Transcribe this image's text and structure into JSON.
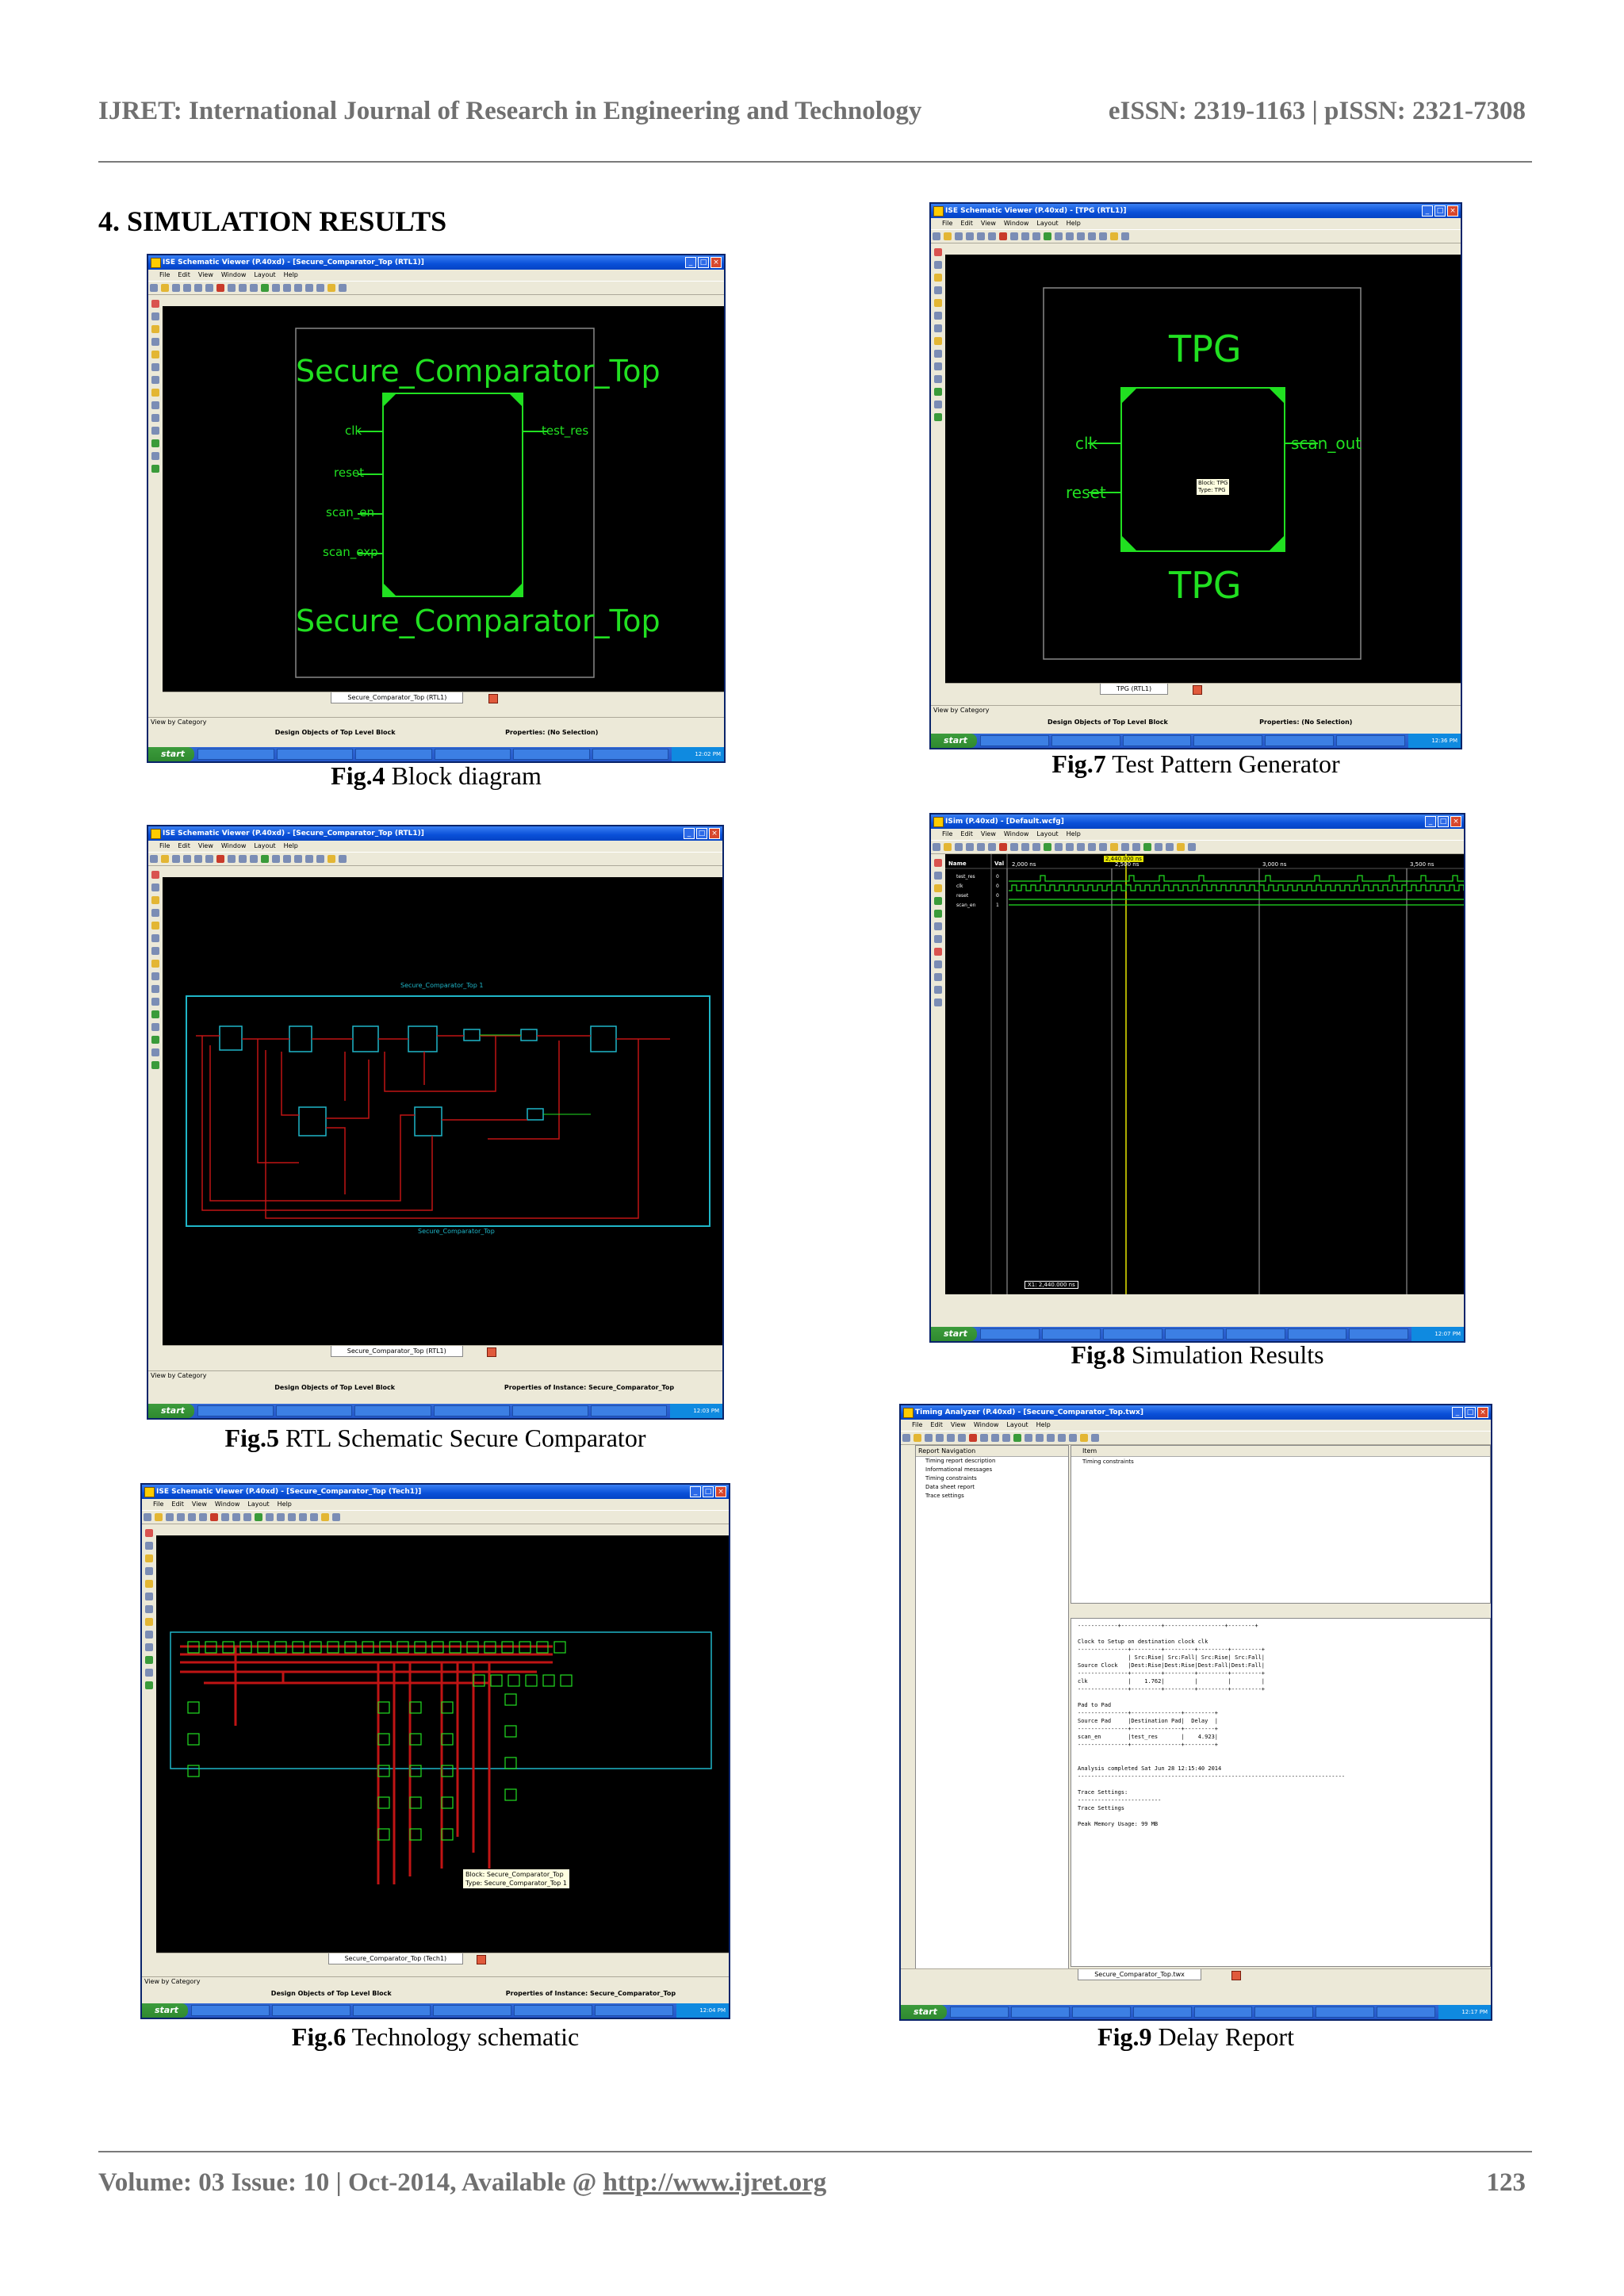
{
  "header": {
    "journal": "IJRET: International Journal of Research in Engineering and Technology",
    "issn": "eISSN: 2319-1163 | pISSN: 2321-7308"
  },
  "section": {
    "title": "4. SIMULATION RESULTS"
  },
  "figures": {
    "fig4": {
      "label": "Fig.4",
      "caption": "Block diagram",
      "window_title": "ISE Schematic Viewer (P.40xd) - [Secure_Comparator_Top (RTL1)]",
      "block_name": "Secure_Comparator_Top",
      "ports_in": [
        "clk",
        "reset",
        "scan_en",
        "scan_exp"
      ],
      "port_out": "test_res",
      "tab": "Secure_Comparator_Top (RTL1)",
      "view_by": "View by Category",
      "pane_left": "Design Objects of Top Level Block",
      "pane_right": "Properties: (No Selection)",
      "start": "start",
      "clock": "12:02 PM"
    },
    "fig5": {
      "label": "Fig.5",
      "caption": "RTL Schematic Secure Comparator",
      "window_title": "ISE Schematic Viewer (P.40xd) - [Secure_Comparator_Top (RTL1)]",
      "tab": "Secure_Comparator_Top (RTL1)",
      "view_by": "View by Category",
      "pane_left": "Design Objects of Top Level Block",
      "pane_right": "Properties of Instance: Secure_Comparator_Top",
      "top_label": "Secure_Comparator_Top 1",
      "bottom_label": "Secure_Comparator_Top",
      "start": "start",
      "clock": "12:03 PM"
    },
    "fig6": {
      "label": "Fig.6",
      "caption": "Technology schematic",
      "window_title": "ISE Schematic Viewer (P.40xd) - [Secure_Comparator_Top (Tech1)]",
      "tab": "Secure_Comparator_Top (Tech1)",
      "view_by": "View by Category",
      "pane_left": "Design Objects of Top Level Block",
      "pane_right": "Properties of Instance: Secure_Comparator_Top",
      "tooltip_block": "Block: Secure_Comparator_Top",
      "tooltip_type": "Type: Secure_Comparator_Top 1",
      "start": "start",
      "clock": "12:04 PM"
    },
    "fig7": {
      "label": "Fig.7",
      "caption": "Test Pattern Generator",
      "window_title": "ISE Schematic Viewer (P.40xd) - [TPG (RTL1)]",
      "block_name": "TPG",
      "ports_in": [
        "clk",
        "reset"
      ],
      "port_out": "scan_out",
      "tooltip_block": "Block: TPG",
      "tooltip_type": "Type: TPG",
      "tab": "TPG (RTL1)",
      "view_by": "View by Category",
      "pane_left": "Design Objects of Top Level Block",
      "pane_right": "Properties: (No Selection)",
      "start": "start",
      "clock": "12:36 PM"
    },
    "fig8": {
      "label": "Fig.8",
      "caption": "Simulation Results",
      "window_title": "ISim (P.40xd) - [Default.wcfg]",
      "cursor_time": "2,440.000 ns",
      "ticks": [
        "2,000 ns",
        "2,500 ns",
        "3,000 ns",
        "3,500 ns"
      ],
      "signal_header": [
        "Name",
        "Val"
      ],
      "signals": [
        {
          "name": "test_res",
          "value": "0"
        },
        {
          "name": "clk",
          "value": "0"
        },
        {
          "name": "reset",
          "value": "0"
        },
        {
          "name": "scan_en",
          "value": "1"
        }
      ],
      "marker": "X1: 2,440.000 ns",
      "start": "start",
      "clock": "12:07 PM"
    },
    "fig9": {
      "label": "Fig.9",
      "caption": "Delay Report",
      "window_title": "Timing Analyzer (P.40xd) - [Secure_Comparator_Top.twx]",
      "nav_header": "Report Navigation",
      "nav_items": [
        "Timing report description",
        "Informational messages",
        "Timing constraints",
        "Data sheet report",
        "Trace settings"
      ],
      "item_header": "Item",
      "item_row": "Timing constraints",
      "report_lines": [
        "------------+------------+------------------+--------+",
        "",
        "Clock to Setup on destination clock clk",
        "---------------+---------+---------+---------+---------+",
        "               | Src:Rise| Src:Fall| Src:Rise| Src:Fall|",
        "Source Clock   |Dest:Rise|Dest:Rise|Dest:Fall|Dest:Fall|",
        "---------------+---------+---------+---------+---------+",
        "clk            |    1.762|         |         |         |",
        "---------------+---------+---------+---------+---------+",
        "",
        "Pad to Pad",
        "---------------+---------------+---------+",
        "Source Pad     |Destination Pad|  Delay  |",
        "---------------+---------------+---------+",
        "scan_en        |test_res       |    4.923|",
        "---------------+---------------+---------+",
        "",
        "",
        "Analysis completed Sat Jun 28 12:15:40 2014",
        "--------------------------------------------------------------------------------",
        "",
        "Trace Settings:",
        "-------------------------",
        "Trace Settings",
        "",
        "Peak Memory Usage: 99 MB"
      ],
      "tab": "Secure_Comparator_Top.twx",
      "start": "start",
      "clock": "12:17 PM"
    }
  },
  "menus": [
    "File",
    "Edit",
    "View",
    "Window",
    "Layout",
    "Help"
  ],
  "footer": {
    "left": "Volume: 03 Issue: 10 | Oct-2014, Available @",
    "link": "http://www.ijret.org",
    "page": "123"
  }
}
